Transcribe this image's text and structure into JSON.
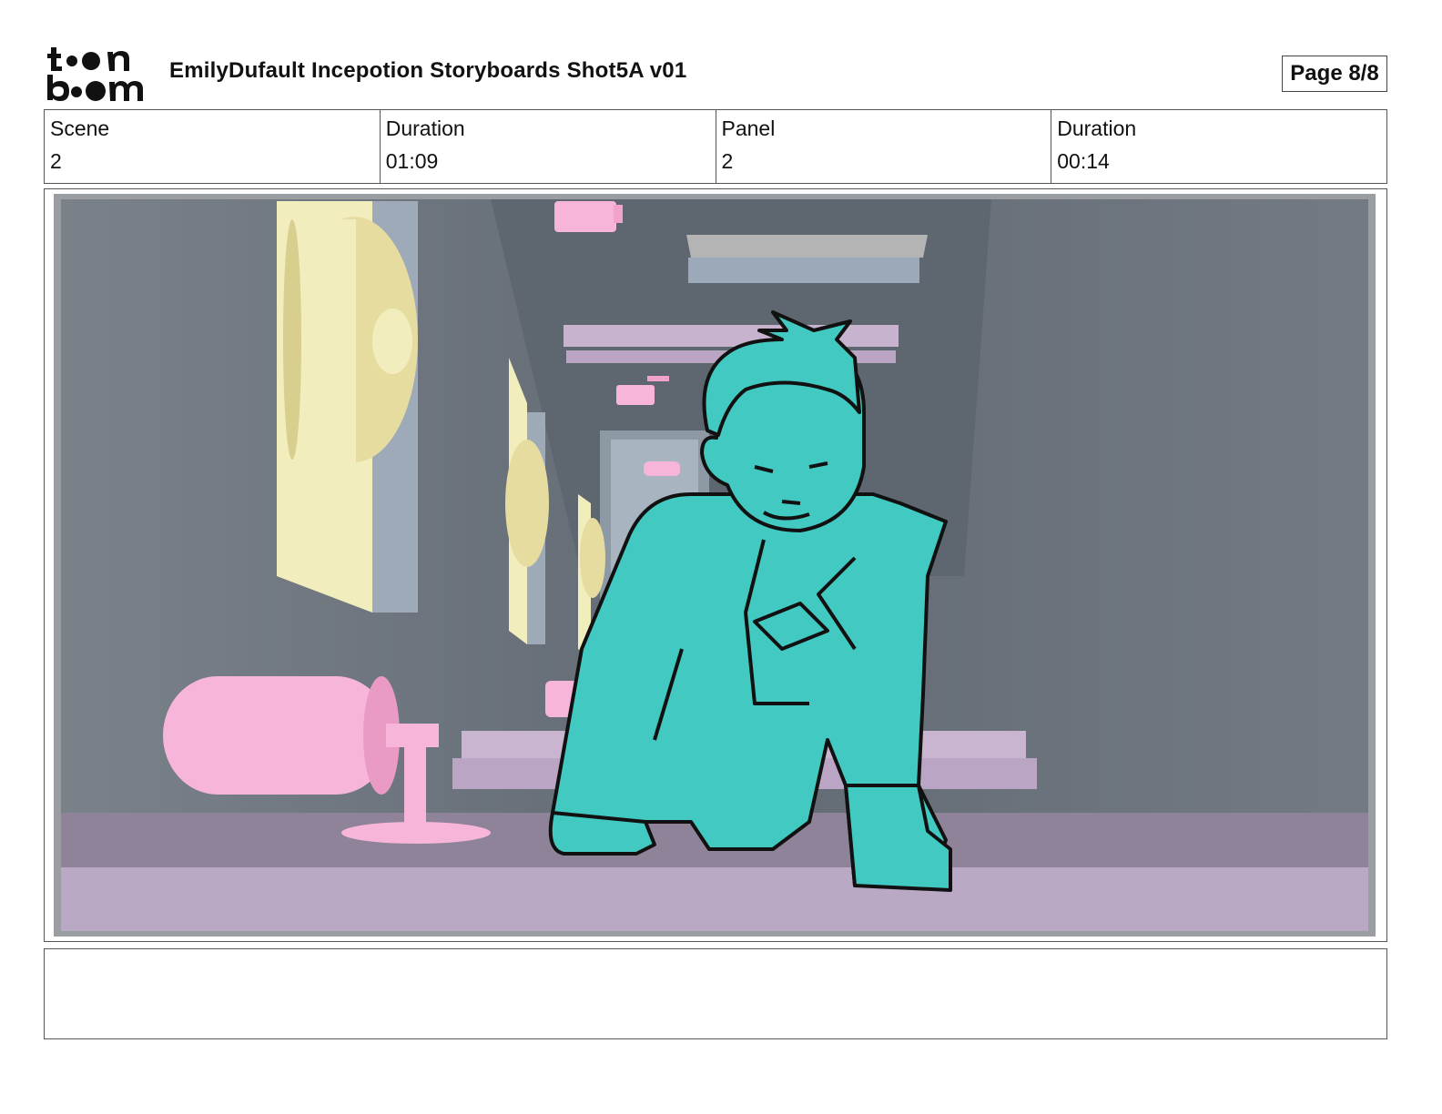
{
  "header": {
    "title": "EmilyDufault Incepotion Storyboards Shot5A v01",
    "page": "Page 8/8",
    "logo": {
      "line1": "toon",
      "line2": "boom"
    }
  },
  "info": {
    "scene_label": "Scene",
    "scene_value": "2",
    "scene_duration_label": "Duration",
    "scene_duration_value": "01:09",
    "panel_label": "Panel",
    "panel_value": "2",
    "panel_duration_label": "Duration",
    "panel_duration_value": "00:14"
  },
  "panel": {
    "description": "",
    "colors": {
      "wall": "#6e757d",
      "floor": "#b9a9c4",
      "character": "#42c9c1",
      "reels": "#f2edbc",
      "pink": "#f7b6d9",
      "lavender": "#c9b5d0"
    }
  },
  "notes": {
    "text": ""
  }
}
